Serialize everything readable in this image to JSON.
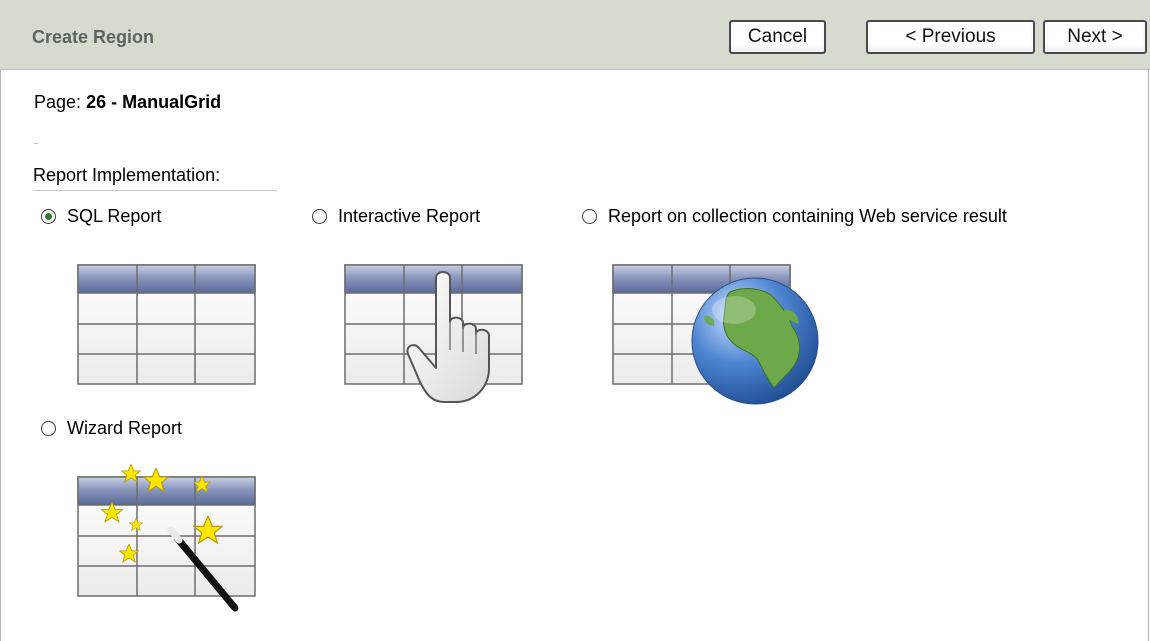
{
  "header": {
    "title": "Create Region",
    "cancel_label": "Cancel",
    "previous_label": "< Previous",
    "next_label": "Next >"
  },
  "page_info": {
    "label": "Page:",
    "value": "26 - ManualGrid"
  },
  "report_implementation": {
    "label": "Report Implementation:",
    "options": [
      {
        "label": "SQL Report",
        "selected": true,
        "icon": "table-grid-icon"
      },
      {
        "label": "Interactive Report",
        "selected": false,
        "icon": "table-hand-pointer-icon"
      },
      {
        "label": "Report on collection containing Web service result",
        "selected": false,
        "icon": "table-globe-icon"
      },
      {
        "label": "Wizard Report",
        "selected": false,
        "icon": "table-magic-wand-icon"
      }
    ]
  },
  "colors": {
    "header_bg": "#d5dccf",
    "header_title": "#5b6560",
    "table_header": "#6b7aa6",
    "radio_selected": "#2a7c2a",
    "star": "#ffe600",
    "globe_ocean": "#3f76c4",
    "globe_land": "#6da84a"
  }
}
